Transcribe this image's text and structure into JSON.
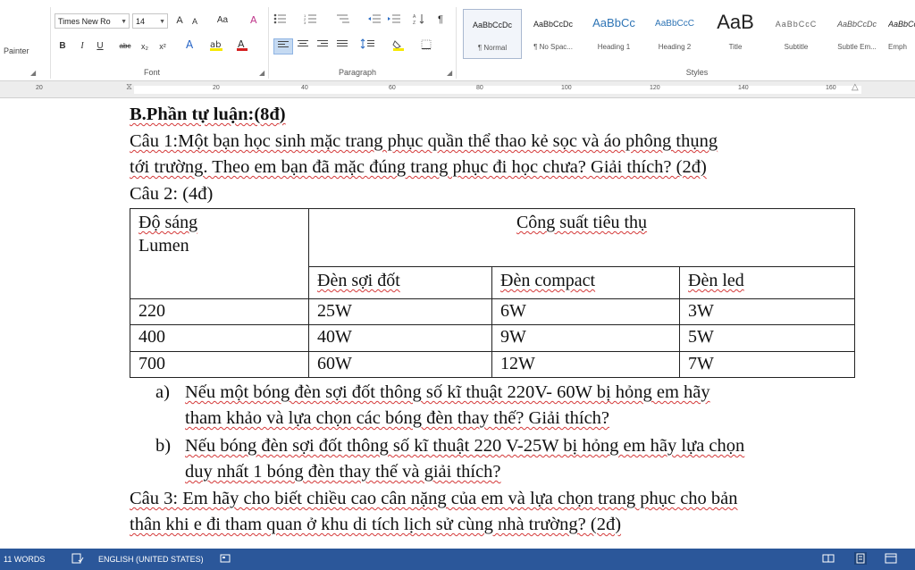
{
  "ribbon": {
    "painter_label": "Painter",
    "font": {
      "name": "Times New Ro",
      "size": "14",
      "grow": "A",
      "shrink": "A",
      "change_case": "Aa",
      "bold": "B",
      "italic": "I",
      "underline": "U",
      "strike": "abc",
      "subscript": "x₂",
      "superscript": "x²",
      "group_label": "Font"
    },
    "paragraph": {
      "group_label": "Paragraph"
    },
    "styles": {
      "group_label": "Styles",
      "items": [
        {
          "sample": "AaBbCcDc",
          "name": "¶ Normal"
        },
        {
          "sample": "AaBbCcDc",
          "name": "¶ No Spac..."
        },
        {
          "sample": "AaBbCc",
          "name": "Heading 1"
        },
        {
          "sample": "AaBbCcC",
          "name": "Heading 2"
        },
        {
          "sample": "AaB",
          "name": "Title"
        },
        {
          "sample": "AaBbCcC",
          "name": "Subtitle"
        },
        {
          "sample": "AaBbCcDc",
          "name": "Subtle Em..."
        },
        {
          "sample": "AaBbCcDc",
          "name": "Emph"
        }
      ]
    },
    "colors": {
      "highlight": "#f6e800",
      "font_color": "#d42020",
      "text_effect": "#1f5fc4"
    }
  },
  "ruler": {
    "labels": [
      "20",
      "20",
      "40",
      "60",
      "80",
      "100",
      "120",
      "140",
      "160"
    ]
  },
  "document": {
    "heading": "B.Phần tự luận:(8đ)",
    "q1_line1": "Câu 1:Một bạn học sinh mặc trang phục quần thể thao kẻ sọc và áo phông thụng",
    "q1_line2": "tới trường. Theo em bạn đã mặc đúng trang phục đi học chưa? Giải thích? (2đ)",
    "q2_title": "Câu 2: (4đ)",
    "table": {
      "brightness_header": [
        "Độ sáng",
        "Lumen"
      ],
      "power_header": "Công suất tiêu thụ",
      "lamp_types": [
        "Đèn sợi đốt",
        "Đèn compact",
        "Đèn led"
      ],
      "rows": [
        [
          "220",
          "25W",
          "6W",
          "3W"
        ],
        [
          "400",
          "40W",
          "9W",
          "5W"
        ],
        [
          "700",
          "60W",
          "12W",
          "7W"
        ]
      ]
    },
    "q2a_label": "a)",
    "q2a_line1": "Nếu một bóng đèn sợi đốt  thông số kĩ thuật  220V- 60W bị hỏng em hãy",
    "q2a_line2": "tham khảo và lựa chọn các bóng đèn thay thế? Giải thích?",
    "q2b_label": "b)",
    "q2b_line1": "Nếu bóng đèn sợi đốt thông số kĩ thuật 220 V-25W bị hỏng em hãy lựa chọn",
    "q2b_line2": "duy nhất 1 bóng đèn thay thế và giải thích?",
    "q3_line1": "Câu 3: Em hãy cho biết chiều cao cân nặng của em và lựa chọn trang phục cho bản",
    "q3_line2": "thân khi e đi tham quan ở khu di tích lịch sử cùng nhà trường? (2đ)"
  },
  "statusbar": {
    "word_count": "11 WORDS",
    "language": "ENGLISH (UNITED STATES)",
    "background": "#2b579a"
  }
}
